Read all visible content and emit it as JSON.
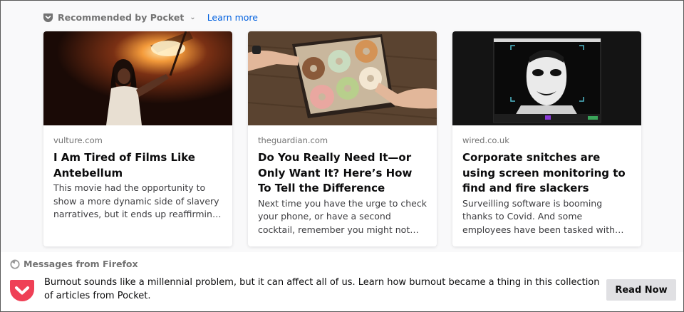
{
  "pocket": {
    "title": "Recommended by Pocket",
    "learn_more": "Learn more"
  },
  "cards": [
    {
      "source": "vulture.com",
      "title": "I Am Tired of Films Like Antebellum",
      "excerpt": "This movie had the opportunity to show a more dynamic side of slavery narratives, but it ends up reaffirmin…",
      "image": "woman-holding-torch-photo"
    },
    {
      "source": "theguardian.com",
      "title": "Do You Really Need It—or Only Want It? Here’s How To Tell the Difference",
      "excerpt": "Next time you have the urge to check your phone, or have a second cocktail, remember you might not…",
      "image": "box-of-donuts-photo"
    },
    {
      "source": "wired.co.uk",
      "title": "Corporate snitches are using screen monitoring to find and fire slackers",
      "excerpt": "Surveilling software is booming thanks to Covid. And some employees have been tasked with…",
      "image": "video-call-inverted-face-screenshot"
    }
  ],
  "messages": {
    "header": "Messages from Firefox",
    "text": "Burnout sounds like a millennial problem, but it can affect all of us. Learn how burnout became a thing in this collection of articles from Pocket.",
    "button": "Read Now"
  },
  "colors": {
    "link": "#0060df",
    "pocket_red": "#ef4056",
    "muted": "#737373"
  }
}
